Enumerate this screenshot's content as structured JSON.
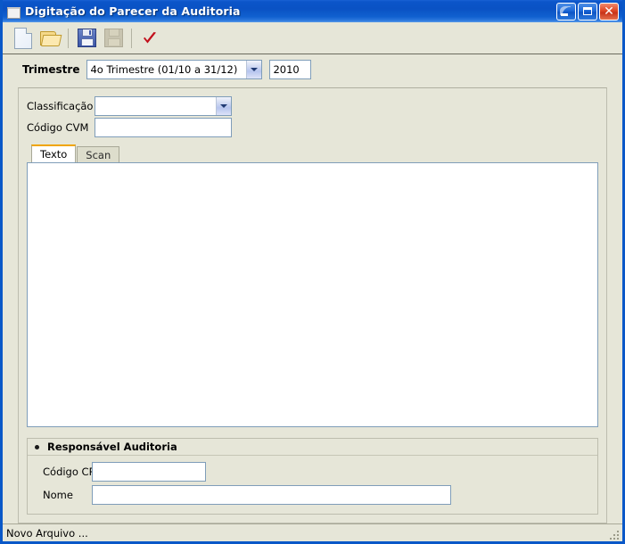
{
  "window": {
    "title": "Digitação do Parecer da Auditoria",
    "icon": "document-icon",
    "controls": {
      "minimize": "minimize-icon",
      "maximize": "maximize-icon",
      "close": "close-icon"
    }
  },
  "toolbar": {
    "buttons": [
      {
        "name": "new-file-button",
        "icon": "new-document-icon",
        "enabled": true
      },
      {
        "name": "open-file-button",
        "icon": "open-folder-icon",
        "enabled": true
      },
      {
        "name": "save-button",
        "icon": "floppy-disk-icon",
        "enabled": true
      },
      {
        "name": "save-as-button",
        "icon": "floppy-disk-disabled-icon",
        "enabled": false
      },
      {
        "name": "confirm-button",
        "icon": "red-check-icon",
        "enabled": true
      }
    ]
  },
  "trimestre": {
    "label": "Trimestre",
    "combo_value": "4o Trimestre (01/10 a 31/12)",
    "year_value": "2010"
  },
  "form": {
    "classificacao": {
      "label": "Classificação",
      "value": "",
      "placeholder": ""
    },
    "codigo_cvm": {
      "label": "Código CVM",
      "value": "",
      "placeholder": ""
    }
  },
  "tabs": [
    {
      "label": "Texto",
      "active": true
    },
    {
      "label": "Scan",
      "active": false
    }
  ],
  "editor": {
    "value": "",
    "placeholder": ""
  },
  "responsavel": {
    "title": "Responsável Auditoria",
    "codigo_crc": {
      "label": "Código CRC",
      "value": "",
      "placeholder": ""
    },
    "nome": {
      "label": "Nome",
      "value": "",
      "placeholder": ""
    }
  },
  "statusbar": {
    "message": "Novo Arquivo ..."
  },
  "colors": {
    "title_bar_blue": "#0a52c4",
    "client_background": "#e6e6d8",
    "field_border": "#7f9db9",
    "active_tab_accent": "#f0a500",
    "check_red": "#c2101c"
  }
}
